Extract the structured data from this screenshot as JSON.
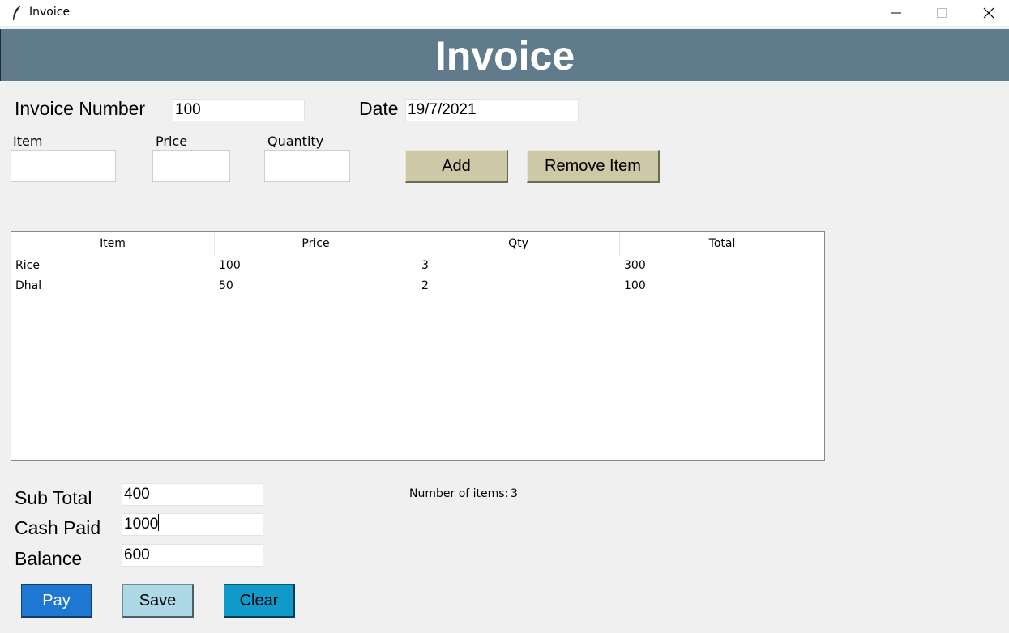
{
  "window": {
    "title": "Invoice",
    "icon": "feather-icon",
    "controls": [
      "minimize-icon",
      "maximize-icon",
      "close-icon"
    ]
  },
  "header": {
    "title": "Invoice",
    "background": "#607b8b"
  },
  "invoice_info": {
    "number_label": "Invoice Number",
    "number_value": "100",
    "date_label": "Date",
    "date_value": "19/7/2021"
  },
  "item_entry": {
    "item_label": "Item",
    "item_value": "",
    "price_label": "Price",
    "price_value": "",
    "quantity_label": "Quantity",
    "quantity_value": "",
    "add_label": "Add",
    "remove_label": "Remove Item"
  },
  "table": {
    "columns": [
      "Item",
      "Price",
      "Qty",
      "Total"
    ],
    "rows": [
      [
        "Rice",
        "100",
        "3",
        "300"
      ],
      [
        "Dhal",
        "50",
        "2",
        "100"
      ]
    ]
  },
  "totals": {
    "subtotal_label": "Sub Total",
    "subtotal_value": "400",
    "cash_label": "Cash Paid",
    "cash_value": "1000",
    "balance_label": "Balance",
    "balance_value": "600",
    "items_count_label": "Number of items:",
    "items_count_value": "3"
  },
  "actions": {
    "pay_label": "Pay",
    "save_label": "Save",
    "clear_label": "Clear",
    "pay_color": "#1e78d2",
    "save_color": "#add8e6",
    "clear_color": "#0f9ac9"
  }
}
